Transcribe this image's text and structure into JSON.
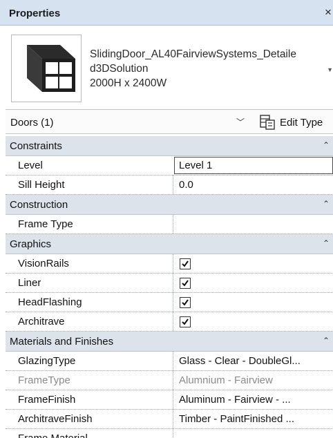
{
  "window": {
    "title": "Properties",
    "close_glyph": "×"
  },
  "type_selector": {
    "thumbnail_icon": "window-door-icon",
    "type_name_line1": "SlidingDoor_AL40FairviewSystems_Detaile",
    "type_name_line2": "d3DSolution",
    "type_name_line3": "2000H x 2400W"
  },
  "instance_selector": {
    "label": "Doors (1)",
    "edit_type_label": "Edit Type"
  },
  "groups": {
    "constraints": {
      "name": "Constraints",
      "level": {
        "name": "Level",
        "value": "Level 1"
      },
      "sill_height": {
        "name": "Sill Height",
        "value": "0.0"
      }
    },
    "construction": {
      "name": "Construction",
      "frame_type": {
        "name": "Frame Type",
        "value": ""
      }
    },
    "graphics": {
      "name": "Graphics",
      "vision_rails": {
        "name": "VisionRails",
        "checked": true
      },
      "liner": {
        "name": "Liner",
        "checked": true
      },
      "head_flashing": {
        "name": "HeadFlashing",
        "checked": true
      },
      "architrave": {
        "name": "Architrave",
        "checked": true
      }
    },
    "materials": {
      "name": "Materials and Finishes",
      "glazing_type": {
        "name": "GlazingType",
        "value": "Glass - Clear - DoubleGl..."
      },
      "frame_type": {
        "name": "FrameType",
        "value": "Alumnium - Fairview"
      },
      "frame_finish": {
        "name": "FrameFinish",
        "value": "Aluminum - Fairview - ..."
      },
      "architrave_finish": {
        "name": "ArchitraveFinish",
        "value": "Timber - PaintFinished ..."
      },
      "frame_material": {
        "name": "Frame Material",
        "value": ""
      }
    }
  },
  "colors": {
    "titlebar": "#d6e2f0",
    "group_header": "#dde3ea",
    "disabled_text": "#8a8a8a"
  }
}
